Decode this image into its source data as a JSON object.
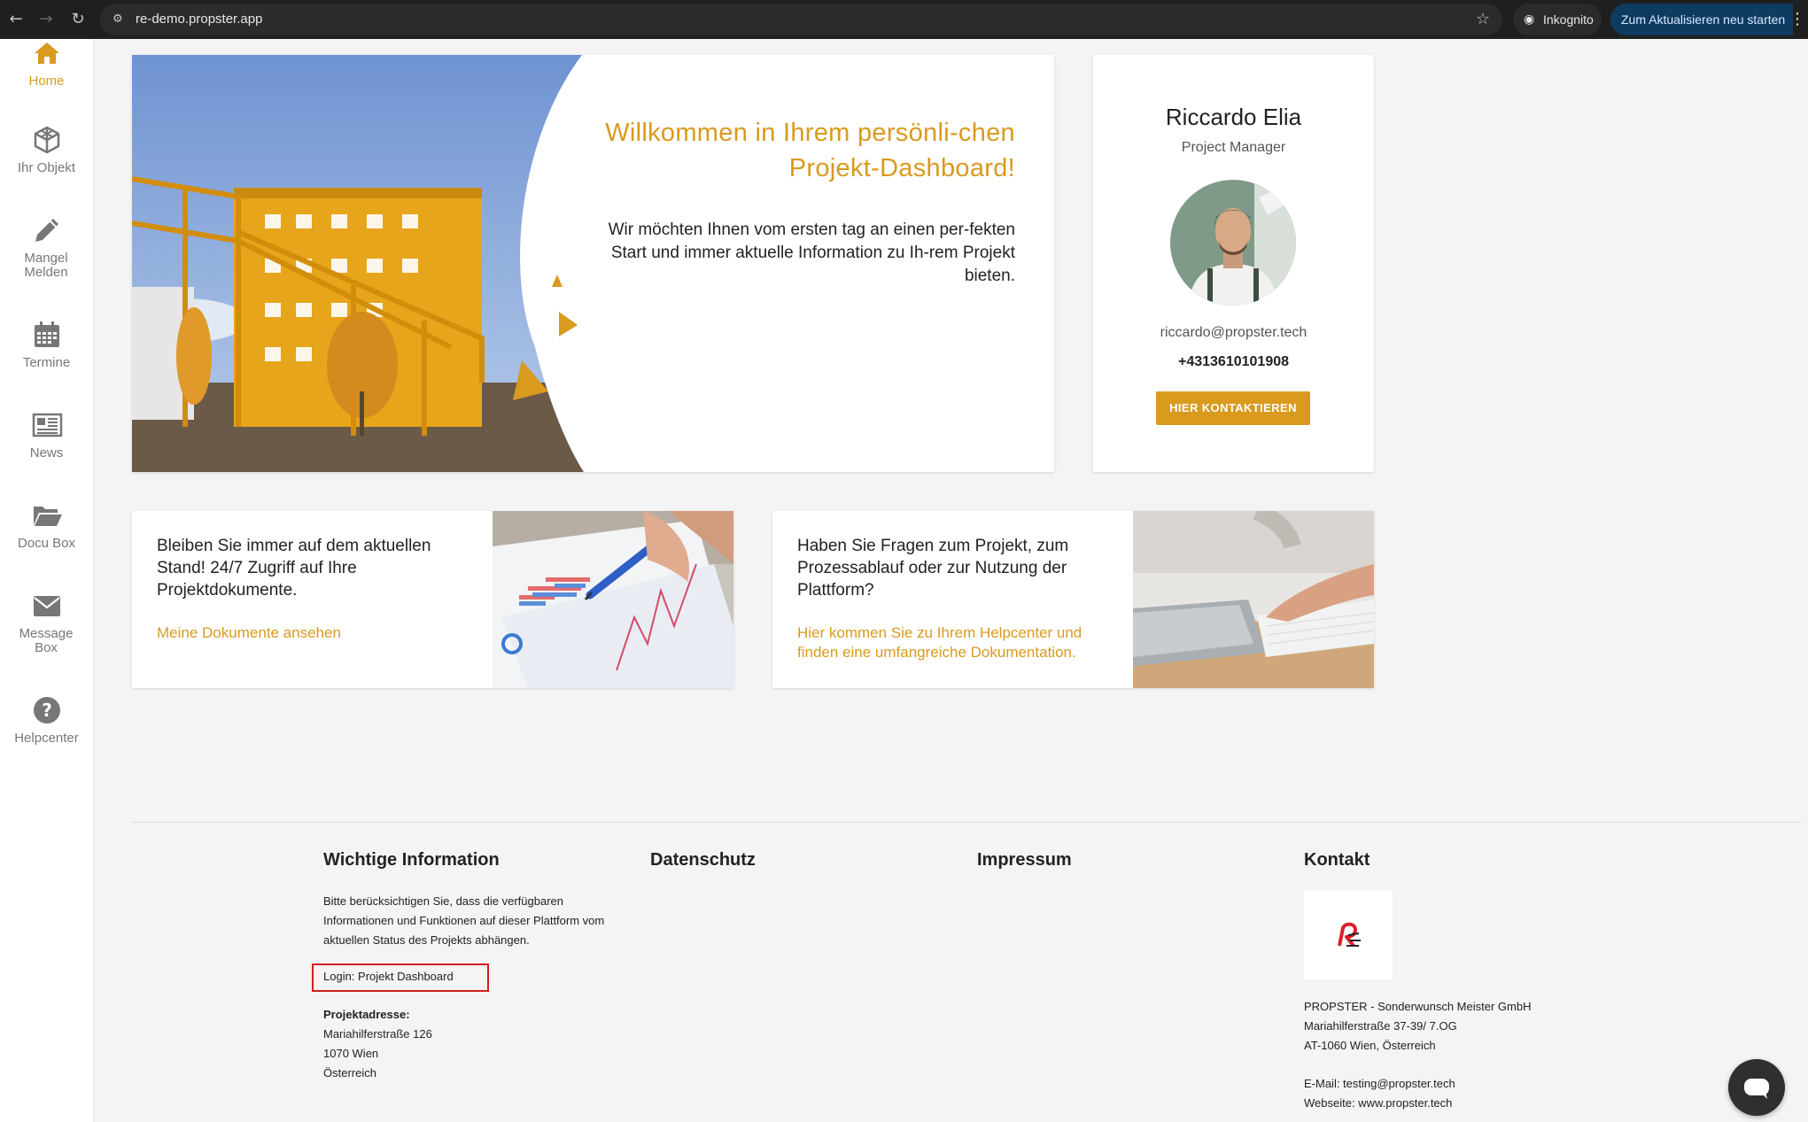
{
  "browser": {
    "url": "re-demo.propster.app",
    "incognito_label": "Inkognito",
    "update_label": "Zum Aktualisieren neu starten"
  },
  "sidebar": {
    "items": [
      {
        "label": "Home",
        "icon": "home-icon",
        "active": true
      },
      {
        "label": "Ihr Objekt",
        "icon": "cube-icon"
      },
      {
        "label": "Mangel Melden",
        "icon": "pencil-icon"
      },
      {
        "label": "Termine",
        "icon": "calendar-icon"
      },
      {
        "label": "News",
        "icon": "newspaper-icon"
      },
      {
        "label": "Docu Box",
        "icon": "folder-icon"
      },
      {
        "label": "Message Box",
        "icon": "envelope-icon"
      },
      {
        "label": "Helpcenter",
        "icon": "help-icon"
      }
    ]
  },
  "hero": {
    "title": "Willkommen in Ihrem persönli-chen Projekt-Dashboard!",
    "text": "Wir möchten Ihnen vom ersten tag an einen per-fekten Start und immer aktuelle Information zu Ih-rem Projekt bieten."
  },
  "contact": {
    "name": "Riccardo Elia",
    "role": "Project Manager",
    "email": "riccardo@propster.tech",
    "phone": "+4313610101908",
    "button": "HIER KONTAKTIEREN"
  },
  "cards": [
    {
      "text": "Bleiben Sie immer auf dem aktuellen Stand! 24/7 Zugriff auf Ihre Projektdokumente.",
      "link": "Meine Dokumente ansehen"
    },
    {
      "text": "Haben Sie Fragen zum Projekt, zum Prozessablauf oder zur Nutzung der Plattform?",
      "link": "Hier kommen Sie zu Ihrem Helpcenter und finden eine umfangreiche Dokumentation."
    }
  ],
  "footer": {
    "col1": {
      "title": "Wichtige Information",
      "text": "Bitte berücksichtigen Sie, dass die verfügbaren Informationen und Funktionen auf dieser Plattform vom aktuellen Status des Projekts abhängen.",
      "login": "Login: Projekt Dashboard",
      "address_label": "Projektadresse:",
      "address_lines": [
        "Mariahilferstraße 126",
        "1070 Wien",
        "Österreich"
      ]
    },
    "col2": {
      "title": "Datenschutz"
    },
    "col3": {
      "title": "Impressum"
    },
    "col4": {
      "title": "Kontakt",
      "company": "PROPSTER - Sonderwunsch Meister GmbH",
      "street": "Mariahilferstraße 37-39/ 7.OG",
      "city": "AT-1060 Wien, Österreich",
      "email": "E-Mail: testing@propster.tech",
      "website": "Webseite: www.propster.tech"
    }
  },
  "colors": {
    "accent": "#d99a1e",
    "highlight_box": "#d21e1e"
  }
}
